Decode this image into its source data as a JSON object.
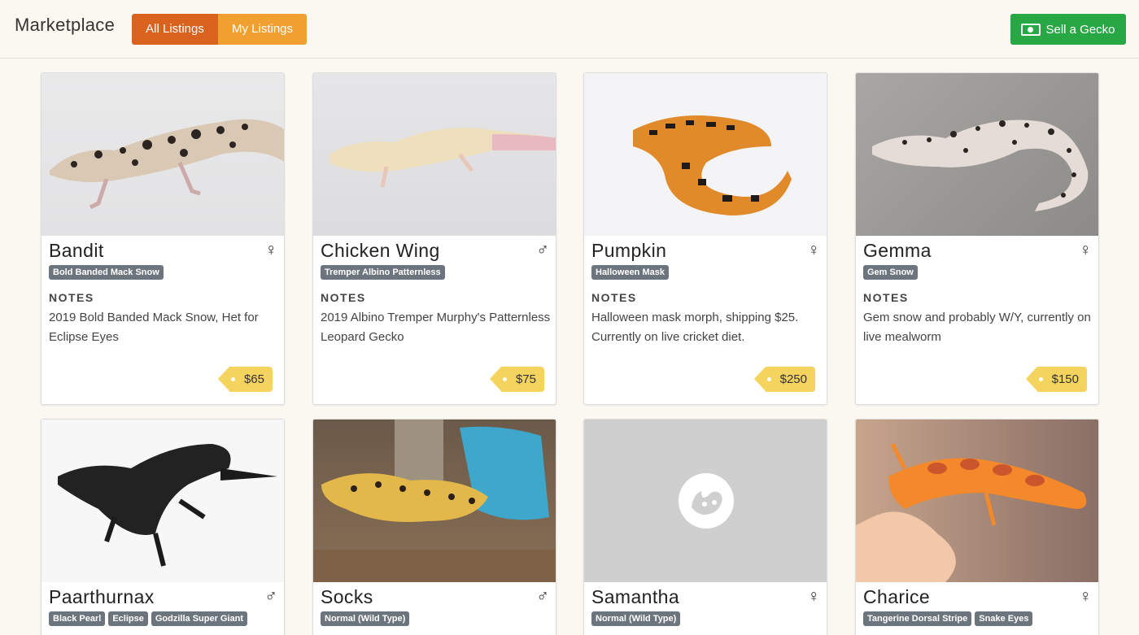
{
  "header": {
    "title": "Marketplace",
    "tabs": [
      "All Listings",
      "My Listings"
    ],
    "sell_label": "Sell a Gecko"
  },
  "notes_heading": "NOTES",
  "listings": [
    {
      "name": "Bandit",
      "sex": "♀",
      "tags": [
        "Bold Banded Mack Snow"
      ],
      "notes": "2019 Bold Banded Mack Snow, Het for Eclipse Eyes",
      "price": "$65"
    },
    {
      "name": "Chicken Wing",
      "sex": "♂",
      "tags": [
        "Tremper Albino Patternless"
      ],
      "notes": "2019 Albino Tremper Murphy's Patternless Leopard Gecko",
      "price": "$75"
    },
    {
      "name": "Pumpkin",
      "sex": "♀",
      "tags": [
        "Halloween Mask"
      ],
      "notes": "Halloween mask morph, shipping $25. Currently on live cricket diet.",
      "price": "$250"
    },
    {
      "name": "Gemma",
      "sex": "♀",
      "tags": [
        "Gem Snow"
      ],
      "notes": "Gem snow and probably W/Y, currently on live mealworm",
      "price": "$150"
    },
    {
      "name": "Paarthurnax",
      "sex": "♂",
      "tags": [
        "Black Pearl",
        "Eclipse",
        "Godzilla Super Giant"
      ]
    },
    {
      "name": "Socks",
      "sex": "♂",
      "tags": [
        "Normal (Wild Type)"
      ]
    },
    {
      "name": "Samantha",
      "sex": "♀",
      "tags": [
        "Normal (Wild Type)"
      ]
    },
    {
      "name": "Charice",
      "sex": "♀",
      "tags": [
        "Tangerine Dorsal Stripe",
        "Snake Eyes"
      ]
    }
  ],
  "colors": {
    "all_listings": "#d9621f",
    "my_listings": "#f0a030",
    "sell": "#28a745",
    "tag": "#6c757d",
    "price_tag": "#f4d35e"
  }
}
